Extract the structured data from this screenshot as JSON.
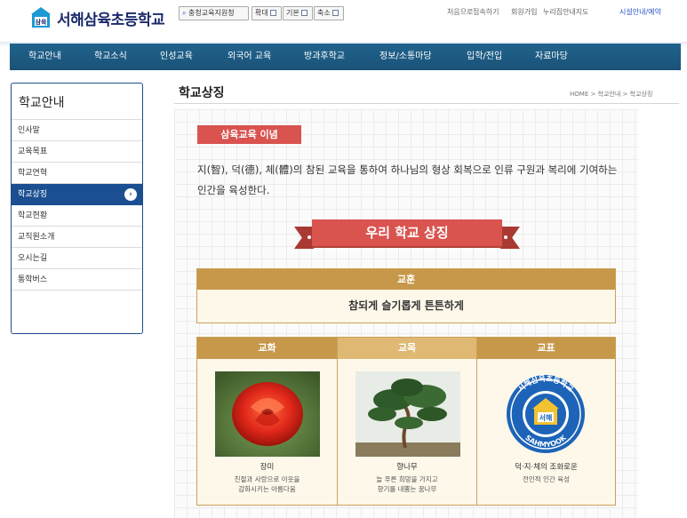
{
  "header": {
    "site_title": "서해삼육초등학교",
    "logo_text": "삼육",
    "tools": {
      "region": "충청교육지원청",
      "zoom_in": "확대",
      "default": "기본",
      "zoom_out": "축소"
    },
    "util_links": [
      "처음으로",
      "접속하기",
      "회원가입",
      "누리집안내지도",
      "시설안내/예약"
    ]
  },
  "gnb": [
    "학교안내",
    "학교소식",
    "인성교육",
    "외국어 교육",
    "방과후학교",
    "정보/소통마당",
    "입학/전입",
    "자료마당"
  ],
  "sidebar": {
    "title": "학교안내",
    "items": [
      {
        "label": "인사말",
        "active": false
      },
      {
        "label": "교육목표",
        "active": false
      },
      {
        "label": "학교연혁",
        "active": false
      },
      {
        "label": "학교상징",
        "active": true
      },
      {
        "label": "학교현황",
        "active": false
      },
      {
        "label": "교직원소개",
        "active": false
      },
      {
        "label": "오시는길",
        "active": false
      },
      {
        "label": "통학버스",
        "active": false
      }
    ],
    "active_arrow": "›"
  },
  "page": {
    "title": "학교상징",
    "breadcrumb": "HOME > 학교안내 > 학교상징"
  },
  "content": {
    "mission_label": "삼육교육 이념",
    "mission_text": "지(智), 덕(德), 체(體)의 참된 교육을 통하여 하나님의 형상 회복으로 인류 구원과 복리에 기여하는 인간을 육성한다.",
    "symbol_banner": "우리 학교 상징",
    "motto": {
      "heading": "교훈",
      "text": "참되게 슬기롭게 튼튼하게"
    },
    "symbols": [
      {
        "heading": "교화",
        "name": "장미",
        "desc": [
          "친절과 사랑으로 이웃을",
          "감화시키는 아름다움"
        ]
      },
      {
        "heading": "교목",
        "name": "향나무",
        "desc": [
          "늘 푸른 희망을 가지고",
          "향기를 내뿜는 꿈나무"
        ]
      },
      {
        "heading": "교표",
        "name": "덕·지·체의 조화로운",
        "desc": [
          "전인적 인간 육성"
        ],
        "emblem_text": "서해삼육초등학교",
        "emblem_en": "SAHMYOOK",
        "emblem_center": "서해"
      }
    ]
  },
  "colors": {
    "brand_navy": "#1c4f92",
    "nav_blue": "#1a5a84",
    "accent_red": "#d9534f",
    "gold": "#c7984a",
    "cream": "#fdf8ea"
  },
  "icons": [
    "school-logo-icon",
    "search-icon",
    "checkbox-icon",
    "arrow-right-icon",
    "rose-image",
    "juniper-tree-image",
    "school-emblem"
  ]
}
